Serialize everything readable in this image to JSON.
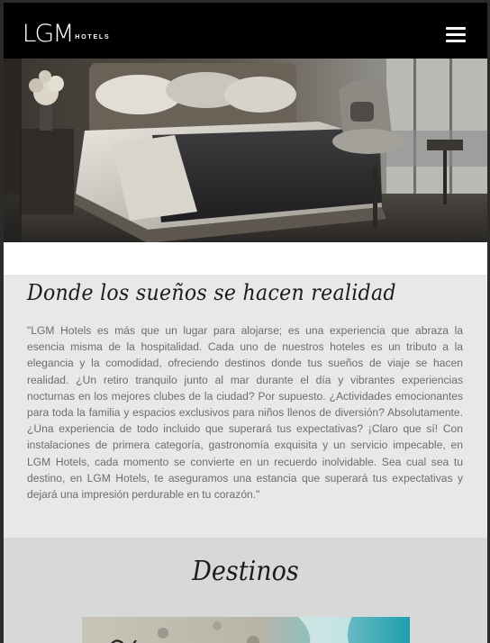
{
  "header": {
    "logo_mark": "LGM",
    "logo_word": "HOTELS",
    "menu_icon": "hamburger-menu-icon"
  },
  "hero": {
    "image": "bedroom-photo"
  },
  "intro": {
    "title": "Donde los sueños se hacen realidad",
    "text": "\"LGM Hotels es más que un lugar para alojarse; es una experiencia que abraza la esencia misma de la hospitalidad. Cada uno de nuestros hoteles es un tributo a la elegancia y la comodidad, ofreciendo destinos donde tus sueños de viaje se hacen realidad. ¿Un retiro tranquilo junto al mar durante el día y vibrantes experiencias nocturnas en los mejores clubes de la ciudad? Por supuesto. ¿Actividades emocionantes para toda la familia y espacios exclusivos para niños llenos de diversión? Absolutamente. ¿Una experiencia de todo incluido que superará tus expectativas? ¡Claro que sí! Con instalaciones de primera categoría, gastronomía exquisita y un servicio impecable, en LGM Hotels, cada momento se convierte en un recuerdo inolvidable. Sea cual sea tu destino, en LGM Hotels, te aseguramos una estancia que superará tus expectativas y dejará una impresión perdurable en tu corazón.\""
  },
  "destinos": {
    "title": "Destinos",
    "card_image": "coastline-aerial-photo"
  },
  "colors": {
    "header_bg": "#000000",
    "section_bg": "#e8e8e8",
    "destinos_bg": "#d8d8d8",
    "text": "#6d6d6d"
  }
}
